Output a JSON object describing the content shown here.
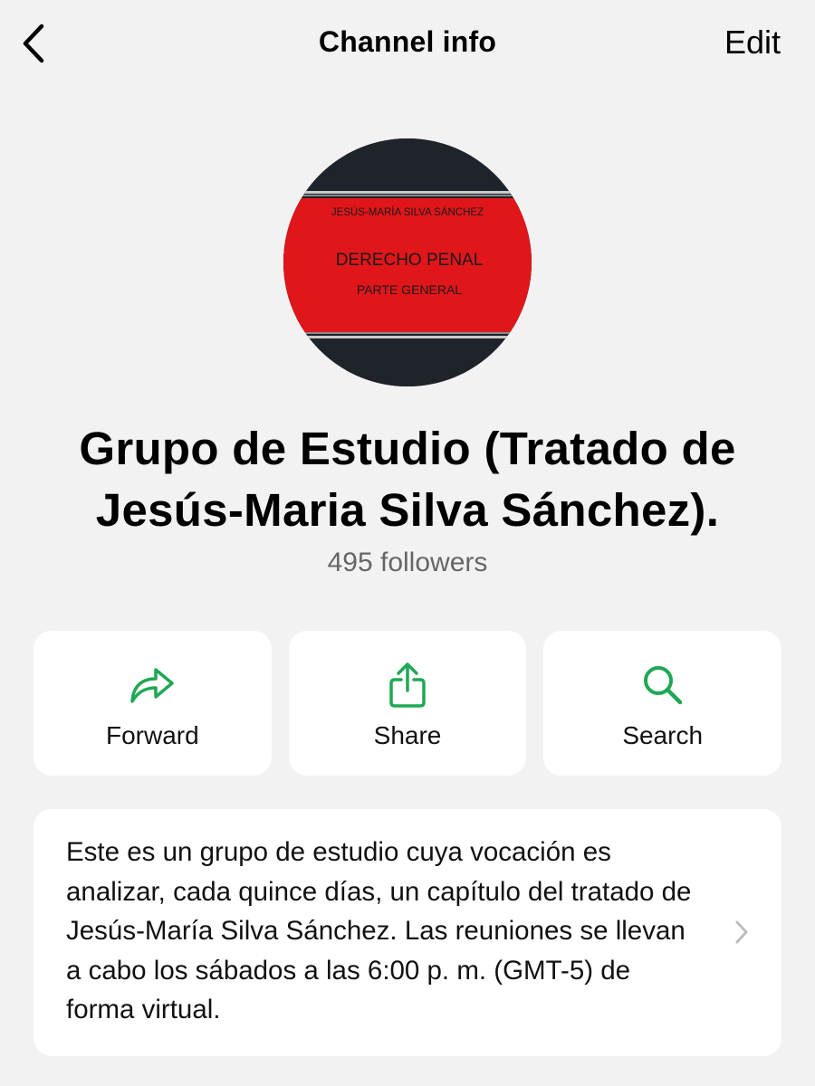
{
  "header": {
    "title": "Channel info",
    "edit_label": "Edit"
  },
  "avatar": {
    "author": "JESÚS-MARÍA SILVA SÁNCHEZ",
    "book_title": "DERECHO PENAL",
    "book_subtitle": "PARTE GENERAL",
    "colors": {
      "cover_red": "#e0161b",
      "cover_dark": "#1f232a"
    }
  },
  "channel": {
    "name": "Grupo de Estudio (Tratado de Jesús-Maria Silva Sánchez).",
    "followers": "495 followers"
  },
  "actions": [
    {
      "label": "Forward",
      "icon": "forward-arrow-icon"
    },
    {
      "label": "Share",
      "icon": "share-icon"
    },
    {
      "label": "Search",
      "icon": "search-icon"
    }
  ],
  "description": {
    "text": "Este es un grupo de estudio cuya vocación es analizar, cada quince días, un capítulo del tratado de Jesús-María Silva Sánchez. Las reuniones se llevan a cabo los sábados a las 6:00 p. m. (GMT-5) de forma virtual."
  },
  "theme": {
    "accent": "#1fa855",
    "background": "#f2f2f2"
  }
}
